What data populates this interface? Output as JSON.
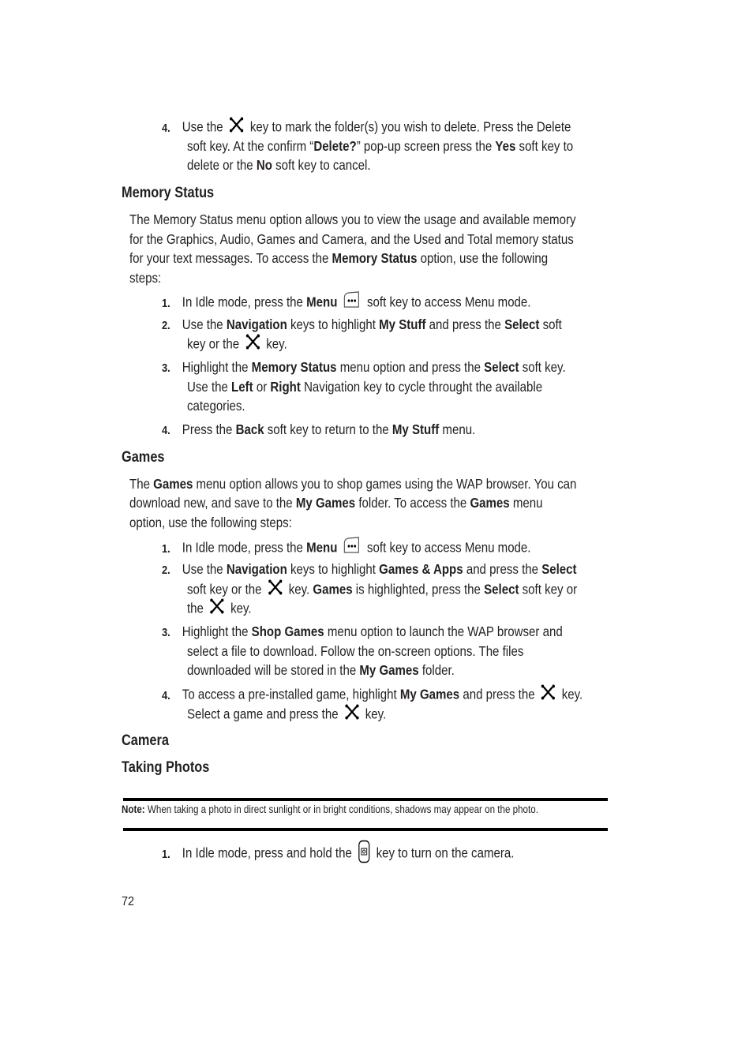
{
  "page_number": "72",
  "top_step": {
    "number": "4.",
    "l1_a": "Use the",
    "l1_b": "key to mark the folder(s) you wish to delete. Press the Delete",
    "l2_a": "soft key. At the confirm “",
    "l2_b": "Delete?",
    "l2_c": "” pop-up screen press the",
    "l2_d": "Yes",
    "l2_e": "soft key to",
    "l3_a": "delete or the",
    "l3_b": "No",
    "l3_c": "soft key to cancel."
  },
  "memory_status": {
    "heading": "Memory Status",
    "p1": "The Memory Status menu option allows you to view the usage and available memory",
    "p2": "for the Graphics, Audio, Games and Camera, and the Used and Total memory status",
    "p3_a": "for your text messages. To access the",
    "p3_b": "Memory Status",
    "p3_c": "option, use the following",
    "p4": "steps:",
    "steps": [
      {
        "n": "1.",
        "a": "In Idle mode, press the",
        "b": "Menu",
        "c": "soft key to access Menu mode."
      },
      {
        "n": "2.",
        "a": "Use the",
        "b": "Navigation",
        "c": "keys to highlight",
        "d": "My Stuff",
        "e": "and press the",
        "f": "Select",
        "g": "soft",
        "l2_a": "key or the",
        "l2_b": "key."
      },
      {
        "n": "3.",
        "a": "Highlight the",
        "b": "Memory Status",
        "c": "menu option and press the",
        "d": "Select",
        "e": "soft key.",
        "l2_a": "Use the",
        "l2_b": "Left",
        "l2_c": "or",
        "l2_d": "Right",
        "l2_e": "Navigation key to cycle throught the available",
        "l3": "categories."
      },
      {
        "n": "4.",
        "a": "Press the",
        "b": "Back",
        "c": "soft key to return to the",
        "d": "My Stuff",
        "e": "menu."
      }
    ]
  },
  "games": {
    "heading": "Games",
    "p1_a": "The",
    "p1_b": "Games",
    "p1_c": "menu option allows you to shop games using the WAP browser. You can",
    "p2_a": "download new, and save to the",
    "p2_b": "My Games",
    "p2_c": "folder. To access the",
    "p2_d": "Games",
    "p2_e": "menu",
    "p3": "option, use the following steps:",
    "steps": [
      {
        "n": "1.",
        "a": "In Idle mode, press the",
        "b": "Menu",
        "c": "soft key to access Menu mode."
      },
      {
        "n": "2.",
        "a": "Use the",
        "b": "Navigation",
        "c": "keys to highlight",
        "d": "Games & Apps",
        "e": "and press the",
        "f": "Select",
        "l2_a": "soft key or the",
        "l2_b": "key.",
        "l2_c": "Games",
        "l2_d": "is highlighted, press the",
        "l2_e": "Select",
        "l2_f": "soft key or",
        "l3_a": "the",
        "l3_b": "key."
      },
      {
        "n": "3.",
        "a": "Highlight the",
        "b": "Shop Games",
        "c": "menu option to launch the WAP browser and",
        "l2": "select a file to download. Follow the on-screen options. The files",
        "l3_a": "downloaded will be stored in the",
        "l3_b": "My Games",
        "l3_c": "folder."
      },
      {
        "n": "4.",
        "a": "To access a pre-installed game, highlight",
        "b": "My Games",
        "c": "and press the",
        "d": "key.",
        "l2_a": "Select a game and press the",
        "l2_b": "key."
      }
    ]
  },
  "camera": {
    "heading": "Camera",
    "subheading": "Taking Photos",
    "note_label": "Note:",
    "note_text": "When taking a photo in direct sunlight or in bright conditions, shadows may appear on the photo.",
    "steps": [
      {
        "n": "1.",
        "a": "In Idle mode, press and hold the",
        "b": "key to turn on the camera."
      }
    ]
  }
}
